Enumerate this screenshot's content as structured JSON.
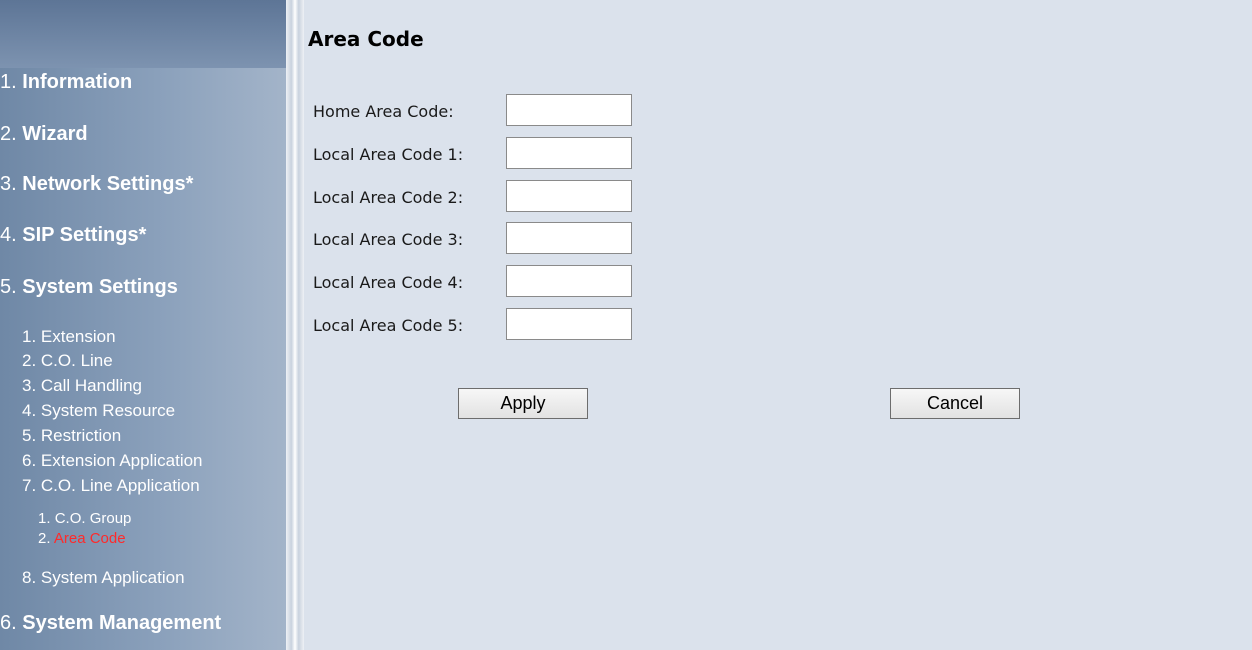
{
  "sidebar": {
    "items": [
      {
        "num": "1.",
        "label": "Information"
      },
      {
        "num": "2.",
        "label": "Wizard"
      },
      {
        "num": "3.",
        "label": "Network Settings*"
      },
      {
        "num": "4.",
        "label": "SIP Settings*"
      },
      {
        "num": "5.",
        "label": "System Settings"
      },
      {
        "num": "6.",
        "label": "System Management"
      }
    ],
    "system_settings_sub": [
      "1. Extension",
      "2. C.O. Line",
      "3. Call Handling",
      "4. System Resource",
      "5. Restriction",
      "6. Extension Application",
      "7. C.O. Line Application",
      "8. System Application"
    ],
    "co_line_app_sub": [
      {
        "num": "1.",
        "label": "C.O. Group"
      },
      {
        "num": "2.",
        "label": "Area Code"
      }
    ]
  },
  "main": {
    "title": "Area Code",
    "fields": [
      {
        "label": "Home Area Code:",
        "value": ""
      },
      {
        "label": "Local Area Code 1:",
        "value": ""
      },
      {
        "label": "Local Area Code 2:",
        "value": ""
      },
      {
        "label": "Local Area Code 3:",
        "value": ""
      },
      {
        "label": "Local Area Code 4:",
        "value": ""
      },
      {
        "label": "Local Area Code 5:",
        "value": ""
      }
    ],
    "apply_label": "Apply",
    "cancel_label": "Cancel"
  },
  "colors": {
    "active_link": "#ff2a2a",
    "main_background": "#dbe2ec",
    "sidebar_background": "#8aa0bb"
  }
}
